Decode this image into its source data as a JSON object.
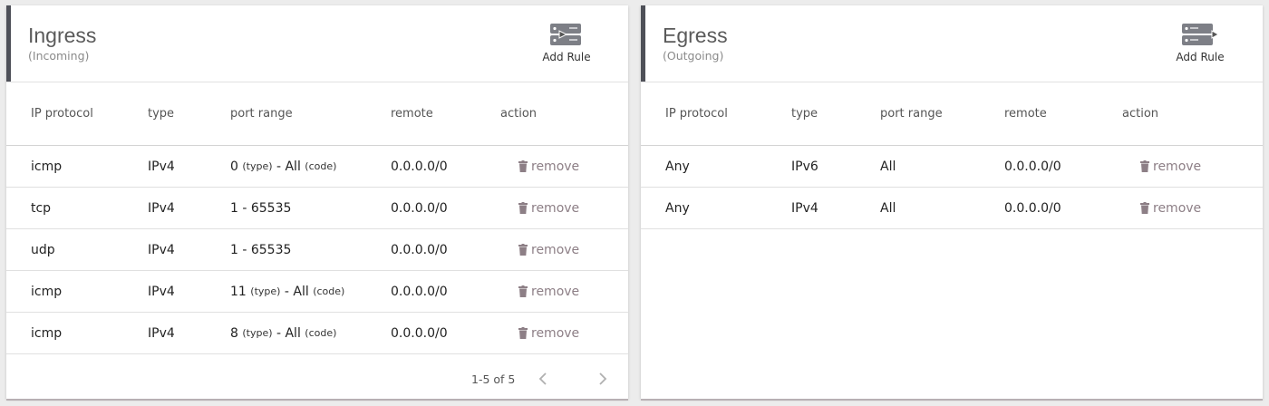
{
  "ingress": {
    "title": "Ingress",
    "subtitle": "(Incoming)",
    "add_rule_label": "Add Rule",
    "add_rule_icon": "add-rule-icon",
    "columns": [
      "IP protocol",
      "type",
      "port range",
      "remote",
      "action"
    ],
    "rows": [
      {
        "protocol": "icmp",
        "type": "IPv4",
        "port_main": "0",
        "port_type": "(type)",
        "port_mid": " - All ",
        "port_code": "(code)",
        "remote": "0.0.0.0/0",
        "action": "remove"
      },
      {
        "protocol": "tcp",
        "type": "IPv4",
        "port_main": "1 - 65535",
        "port_type": "",
        "port_mid": "",
        "port_code": "",
        "remote": "0.0.0.0/0",
        "action": "remove"
      },
      {
        "protocol": "udp",
        "type": "IPv4",
        "port_main": "1 - 65535",
        "port_type": "",
        "port_mid": "",
        "port_code": "",
        "remote": "0.0.0.0/0",
        "action": "remove"
      },
      {
        "protocol": "icmp",
        "type": "IPv4",
        "port_main": "11",
        "port_type": "(type)",
        "port_mid": " - All ",
        "port_code": "(code)",
        "remote": "0.0.0.0/0",
        "action": "remove"
      },
      {
        "protocol": "icmp",
        "type": "IPv4",
        "port_main": "8",
        "port_type": "(type)",
        "port_mid": " - All ",
        "port_code": "(code)",
        "remote": "0.0.0.0/0",
        "action": "remove"
      }
    ],
    "pagination": {
      "text": "1-5 of 5"
    }
  },
  "egress": {
    "title": "Egress",
    "subtitle": "(Outgoing)",
    "add_rule_label": "Add Rule",
    "add_rule_icon": "add-rule-icon",
    "columns": [
      "IP protocol",
      "type",
      "port range",
      "remote",
      "action"
    ],
    "rows": [
      {
        "protocol": "Any",
        "type": "IPv6",
        "port_main": "All",
        "port_type": "",
        "port_mid": "",
        "port_code": "",
        "remote": "0.0.0.0/0",
        "action": "remove"
      },
      {
        "protocol": "Any",
        "type": "IPv4",
        "port_main": "All",
        "port_type": "",
        "port_mid": "",
        "port_code": "",
        "remote": "0.0.0.0/0",
        "action": "remove"
      }
    ]
  },
  "colors": {
    "header_accent": "#4e5058",
    "remove_text": "#8d7f86",
    "background": "#ececec"
  },
  "icons": [
    "add-rule-icon",
    "trash-icon",
    "chevron-left-icon",
    "chevron-right-icon"
  ]
}
